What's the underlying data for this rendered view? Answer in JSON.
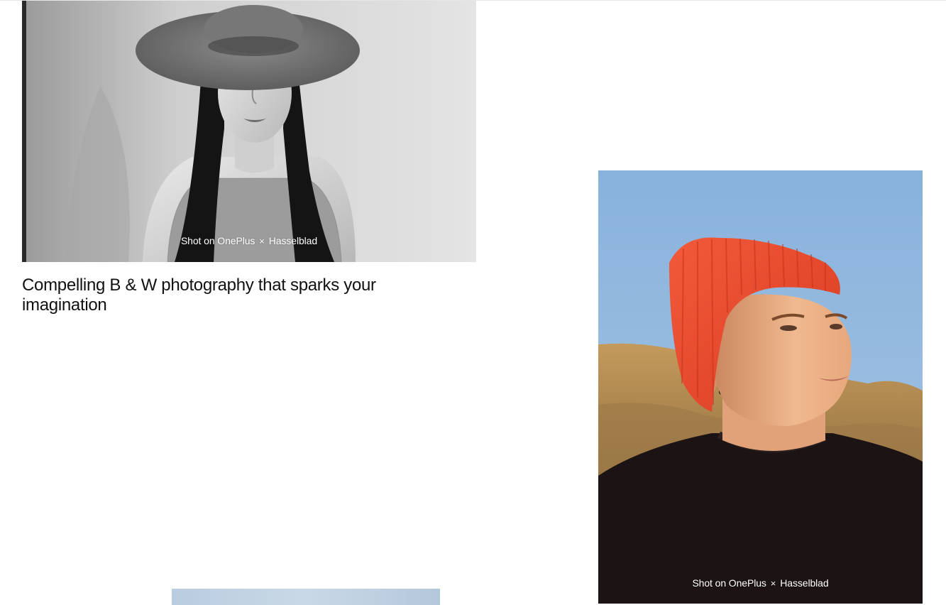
{
  "gallery": {
    "items": [
      {
        "caption_left": "Shot on OnePlus",
        "caption_sep": "×",
        "caption_right": "Hasselblad",
        "headline": "Compelling B & W photography that sparks your imagination"
      },
      {
        "caption_left": "Shot on OnePlus",
        "caption_sep": "×",
        "caption_right": "Hasselblad"
      }
    ]
  },
  "colors": {
    "background": "#ffffff",
    "text": "#111111",
    "caption": "#ffffff",
    "sky": "#8fb6dc",
    "beanie": "#e8452c"
  }
}
